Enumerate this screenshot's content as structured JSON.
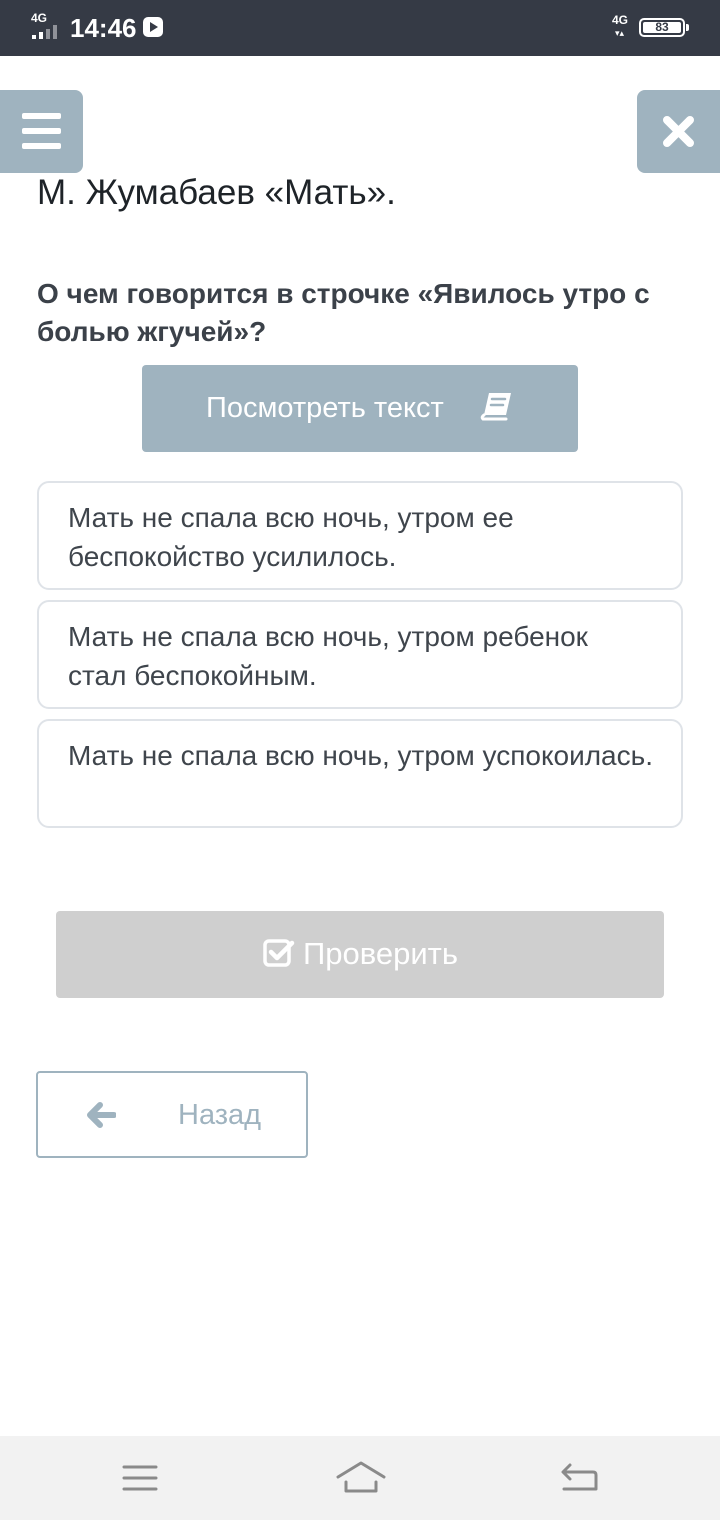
{
  "status_bar": {
    "network_left": "4G",
    "time": "14:46",
    "network_right": "4G",
    "battery": "83"
  },
  "page_title": "М. Жумабаев «Мать».",
  "question": "О чем говорится в строчке «Явилось утро с болью жгучей»?",
  "view_text_button": {
    "label": "Посмотреть текст",
    "icon": "book-icon"
  },
  "options": [
    {
      "text": "Мать не спала всю ночь, утром ее беспокойство усилилось."
    },
    {
      "text": "Мать не спала всю ночь, утром ребенок стал беспокойным."
    },
    {
      "text": "Мать не спала всю ночь, утром успокоилась."
    }
  ],
  "check_button": {
    "label": "Проверить",
    "icon": "check-square-icon"
  },
  "back_button": {
    "label": "Назад",
    "icon": "arrow-left-icon"
  },
  "colors": {
    "status_bar": "#353a45",
    "accent": "#9fb3bf",
    "disabled": "#cfcfcf",
    "option_border": "#dfe3e8",
    "nav_bar": "#f2f2f2"
  }
}
